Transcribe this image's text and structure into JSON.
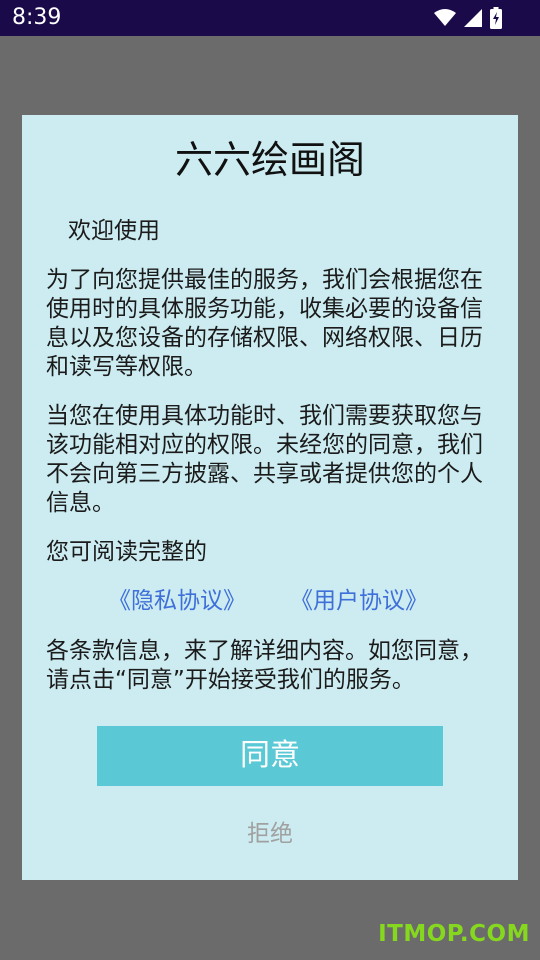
{
  "status_bar": {
    "time": "8:39",
    "icons": [
      "wifi-icon",
      "cell-signal-icon",
      "battery-charging-icon"
    ]
  },
  "dialog": {
    "title": "六六绘画阁",
    "welcome": "欢迎使用",
    "paragraph1": "为了向您提供最佳的服务，我们会根据您在使用时的具体服务功能，收集必要的设备信息以及您设备的存储权限、网络权限、日历和读写等权限。",
    "paragraph2": "当您在使用具体功能时、我们需要获取您与该功能相对应的权限。未经您的同意，我们不会向第三方披露、共享或者提供您的个人信息。",
    "paragraph3": "您可阅读完整的",
    "privacy_link": "《隐私协议》",
    "user_link": "《用户协议》",
    "paragraph4": "各条款信息，来了解详细内容。如您同意，请点击“同意”开始接受我们的服务。",
    "agree_label": "同意",
    "reject_label": "拒绝"
  },
  "watermark": "ITMOP.COM",
  "colors": {
    "status_bar": "#1a0a4a",
    "scrim": "#6b6b6b",
    "dialog_bg": "#ccecf1",
    "link": "#3f6fd8",
    "agree_button": "#5bc8d6",
    "reject_text": "#a0a0a0",
    "watermark": "#86d81f"
  }
}
